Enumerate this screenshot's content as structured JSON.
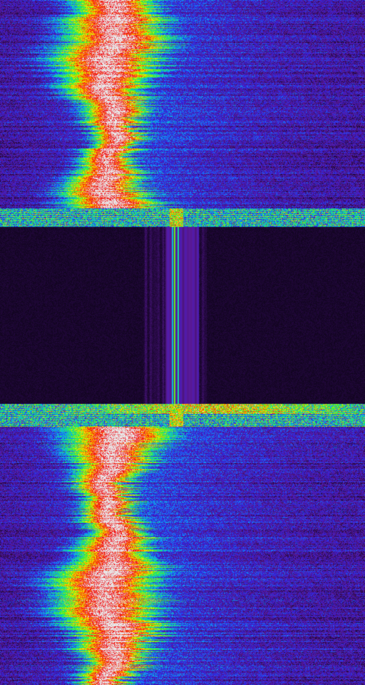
{
  "image": {
    "kind": "waterfall-spectrogram",
    "colormap": [
      "#05020a",
      "#2a0a4a",
      "#5a1a9a",
      "#3020e0",
      "#1090ff",
      "#10e0a0",
      "#40f020",
      "#f0f000",
      "#ff8000",
      "#f00010",
      "#e8e8e8"
    ],
    "regions": [
      {
        "name": "upper-band",
        "kind": "signal"
      },
      {
        "name": "transition-top",
        "kind": "noise"
      },
      {
        "name": "quiet-band",
        "kind": "dark"
      },
      {
        "name": "transition-bottom",
        "kind": "noise"
      },
      {
        "name": "lower-band",
        "kind": "signal"
      }
    ]
  }
}
